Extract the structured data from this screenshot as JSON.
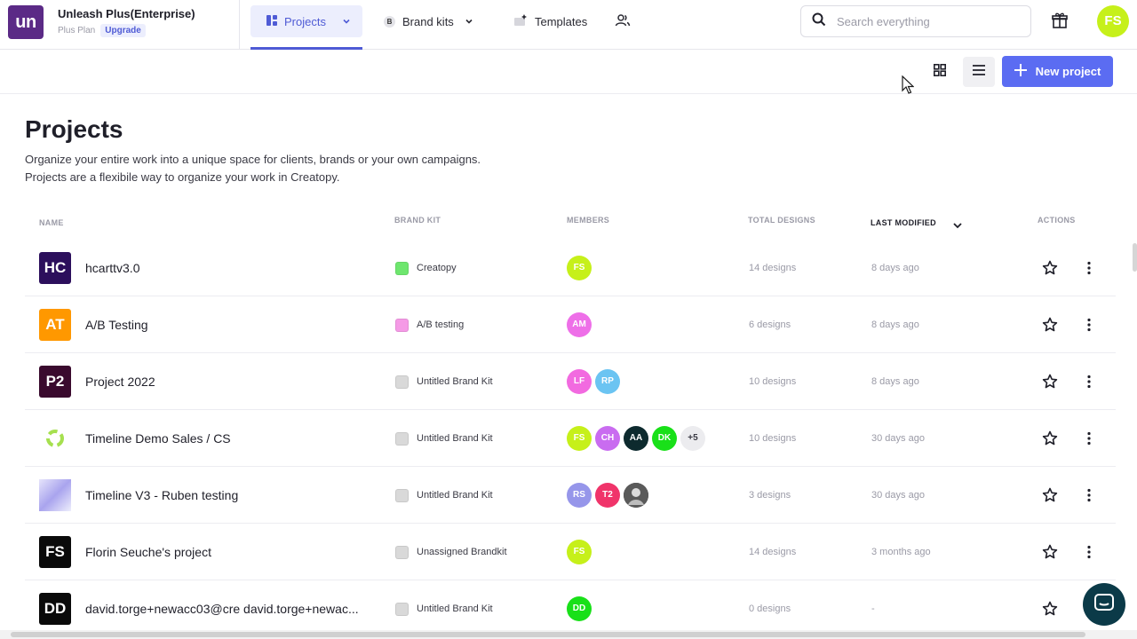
{
  "header": {
    "logo_text": "un",
    "org_name": "Unleash Plus(Enterprise)",
    "plan": "Plus Plan",
    "upgrade_label": "Upgrade",
    "nav": [
      {
        "label": "Projects",
        "icon": "projects-grid-icon"
      },
      {
        "label": "Brand kits",
        "icon": "brand-kit-icon",
        "badge": "B"
      },
      {
        "label": "Templates",
        "icon": "templates-icon"
      },
      {
        "label": "",
        "icon": "team-members-icon"
      }
    ],
    "search_placeholder": "Search everything",
    "user_initials": "FS"
  },
  "toolbar": {
    "new_project_label": "New project"
  },
  "page": {
    "title": "Projects",
    "desc_line1": "Organize your entire work into a unique space for clients, brands or your own campaigns.",
    "desc_line2": "Projects are a flexibile way to organize your work in Creatopy."
  },
  "table": {
    "columns": {
      "name": "NAME",
      "brand_kit": "BRAND KIT",
      "members": "MEMBERS",
      "total_designs": "TOTAL DESIGNS",
      "last_modified": "LAST MODIFIED",
      "actions": "ACTIONS"
    },
    "rows": [
      {
        "icon_text": "HC",
        "icon_color": "#2c0f5c",
        "name": "hcarttv3.0",
        "brand_kit": "Creatopy",
        "swatch": "#6ee66e",
        "members": [
          {
            "i": "FS",
            "c": "#c6f01a"
          }
        ],
        "designs": "14 designs",
        "modified": "8 days ago"
      },
      {
        "icon_text": "AT",
        "icon_color": "#ff9800",
        "name": "A/B Testing",
        "brand_kit": "A/B testing",
        "swatch": "#f59ae6",
        "members": [
          {
            "i": "AM",
            "c": "#ee6fe8"
          }
        ],
        "designs": "6 designs",
        "modified": "8 days ago"
      },
      {
        "icon_text": "P2",
        "icon_color": "#3a0a2e",
        "name": "Project 2022",
        "brand_kit": "Untitled Brand Kit",
        "swatch": "#d9d9d9",
        "members": [
          {
            "i": "LF",
            "c": "#f26ae0"
          },
          {
            "i": "RP",
            "c": "#6bc4f2"
          }
        ],
        "designs": "10 designs",
        "modified": "8 days ago"
      },
      {
        "icon_text": "",
        "icon_color": "#ffffff",
        "name": "Timeline Demo Sales / CS",
        "brand_kit": "Untitled Brand Kit",
        "swatch": "#d9d9d9",
        "members": [
          {
            "i": "FS",
            "c": "#c6f01a"
          },
          {
            "i": "CH",
            "c": "#c96cf0"
          },
          {
            "i": "AA",
            "c": "#0d2a2e"
          },
          {
            "i": "DK",
            "c": "#19e019"
          },
          {
            "i": "+5",
            "c": "#ececef"
          }
        ],
        "designs": "10 designs",
        "modified": "30 days ago"
      },
      {
        "icon_text": "",
        "icon_color": "#c9c7f5",
        "name": "Timeline V3 - Ruben testing",
        "brand_kit": "Untitled Brand Kit",
        "swatch": "#d9d9d9",
        "members": [
          {
            "i": "RS",
            "c": "#9696ea"
          },
          {
            "i": "T2",
            "c": "#f0346a"
          },
          {
            "i": "",
            "c": "#3b3b3b"
          }
        ],
        "designs": "3 designs",
        "modified": "30 days ago"
      },
      {
        "icon_text": "FS",
        "icon_color": "#0a0a0a",
        "name": "Florin Seuche's project",
        "brand_kit": "Unassigned Brandkit",
        "swatch": "#d9d9d9",
        "members": [
          {
            "i": "FS",
            "c": "#c6f01a"
          }
        ],
        "designs": "14 designs",
        "modified": "3 months ago"
      },
      {
        "icon_text": "DD",
        "icon_color": "#0a0a0a",
        "name": "david.torge+newacc03@cre david.torge+newac...",
        "brand_kit": "Untitled Brand Kit",
        "swatch": "#d9d9d9",
        "members": [
          {
            "i": "DD",
            "c": "#19e019"
          }
        ],
        "designs": "0 designs",
        "modified": "-"
      }
    ]
  },
  "colors": {
    "accent": "#5b6cf2",
    "nav_active": "#4f5bd5",
    "logo_bg": "#5b2a86",
    "chat_bg": "#0b3a48"
  }
}
